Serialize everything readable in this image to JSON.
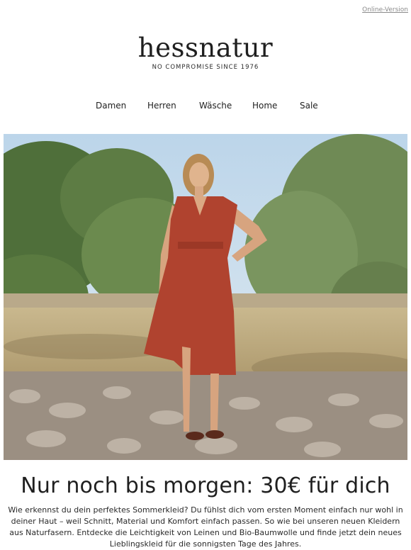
{
  "header": {
    "online_version": "Online-Version",
    "logo": "hessnatur",
    "tagline": "NO COMPROMISE SINCE 1976"
  },
  "nav": {
    "items": [
      {
        "label": "Damen"
      },
      {
        "label": "Herren"
      },
      {
        "label": "Wäsche"
      },
      {
        "label": "Home"
      },
      {
        "label": "Sale"
      }
    ]
  },
  "hero": {
    "icon": "hero-photo-woman-red-dress",
    "colors": {
      "sky": "#cfe0ee",
      "trees": "#5f7f45",
      "ground": "#bfae85",
      "dress": "#b0432f"
    }
  },
  "main": {
    "headline": "Nur noch bis morgen: 30€ für dich",
    "body": "Wie erkennst du dein perfektes Sommerkleid? Du fühlst dich vom ersten Moment einfach nur wohl in deiner Haut – weil Schnitt, Material und Komfort einfach passen. So wie bei unseren neuen Kleidern aus Naturfasern. Entdecke die Leichtigkeit von Leinen und Bio-Baumwolle und finde jetzt dein neues Lieblingskleid für die sonnigsten Tage des Jahres."
  }
}
